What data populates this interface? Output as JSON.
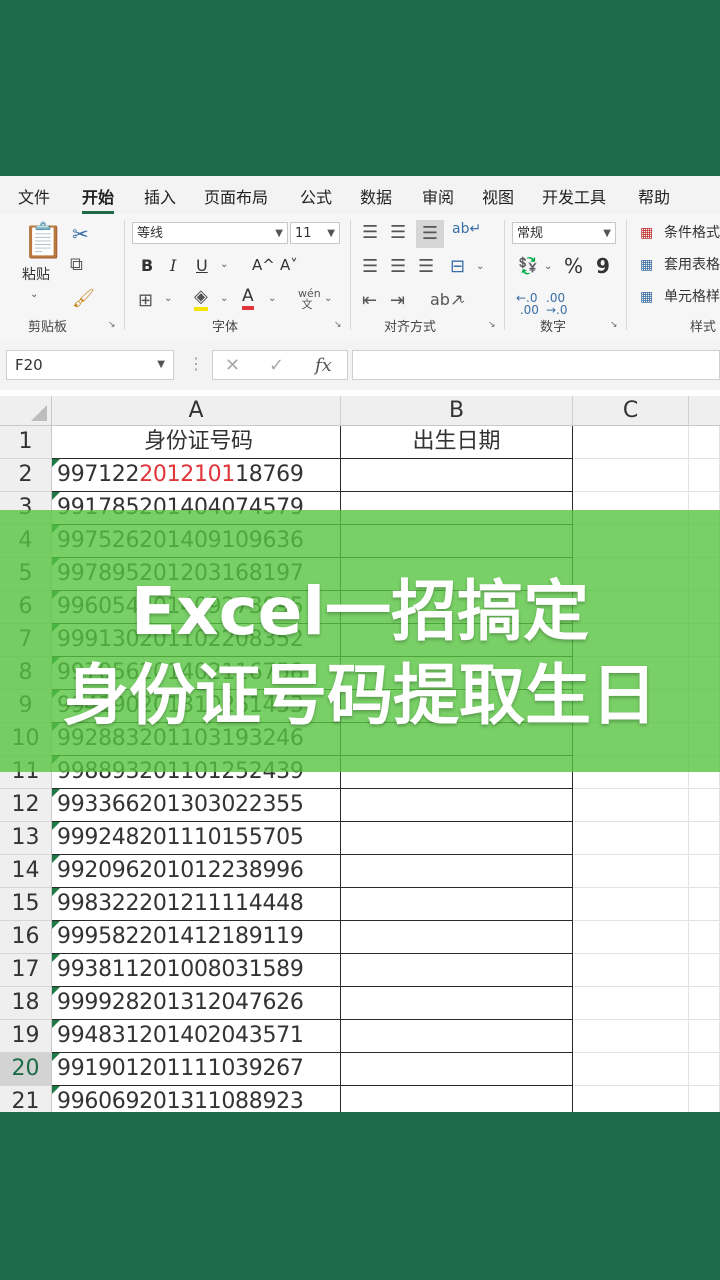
{
  "ribbon_tabs": [
    "文件",
    "开始",
    "插入",
    "页面布局",
    "公式",
    "数据",
    "审阅",
    "视图",
    "开发工具",
    "帮助"
  ],
  "ribbon": {
    "paste_label": "粘贴",
    "font_name": "等线",
    "font_size": "11",
    "number_format": "常规",
    "bold": "B",
    "italic": "I",
    "underline": "U",
    "grow_font": "A^",
    "shrink_font": "A˅",
    "font_color": "A",
    "percent": "%",
    "comma": "9",
    "conditional_format": "条件格式",
    "table_format": "套用表格",
    "cell_style": "单元格样",
    "groups": {
      "clipboard": "剪贴板",
      "font": "字体",
      "alignment": "对齐方式",
      "number": "数字",
      "styles": "样式"
    }
  },
  "formula_bar": {
    "name_box": "F20",
    "cancel": "✕",
    "enter": "✓",
    "fx": "fx",
    "value": ""
  },
  "columns": [
    "A",
    "B",
    "C"
  ],
  "rows": [
    {
      "n": "1",
      "a": "身份证号码",
      "b": "出生日期"
    },
    {
      "n": "2",
      "a_pre": "997122",
      "a_red": "2012101",
      "a_post": "18769",
      "b": ""
    },
    {
      "n": "3",
      "a": "991785201404074579",
      "b": ""
    },
    {
      "n": "4",
      "a": "997526201409109636",
      "b": ""
    },
    {
      "n": "5",
      "a": "997895201203168197",
      "b": ""
    },
    {
      "n": "6",
      "a": "996054201409273095",
      "b": ""
    },
    {
      "n": "7",
      "a": "999130201102208352",
      "b": ""
    },
    {
      "n": "8",
      "a": "997056201402116758",
      "b": ""
    },
    {
      "n": "9",
      "a": "994190201310261453",
      "b": ""
    },
    {
      "n": "10",
      "a": "992883201103193246",
      "b": ""
    },
    {
      "n": "11",
      "a": "998893201101252439",
      "b": ""
    },
    {
      "n": "12",
      "a": "993366201303022355",
      "b": ""
    },
    {
      "n": "13",
      "a": "999248201110155705",
      "b": ""
    },
    {
      "n": "14",
      "a": "992096201012238996",
      "b": ""
    },
    {
      "n": "15",
      "a": "998322201211114448",
      "b": ""
    },
    {
      "n": "16",
      "a": "999582201412189119",
      "b": ""
    },
    {
      "n": "17",
      "a": "993811201008031589",
      "b": ""
    },
    {
      "n": "18",
      "a": "999928201312047626",
      "b": ""
    },
    {
      "n": "19",
      "a": "994831201402043571",
      "b": ""
    },
    {
      "n": "20",
      "a": "991901201111039267",
      "b": ""
    },
    {
      "n": "21",
      "a": "996069201311088923",
      "b": ""
    }
  ],
  "selected_row": "20",
  "overlay": {
    "line1": "Excel一招搞定",
    "line2": "身份证号码提取生日",
    "color": "#56c440"
  },
  "colors": {
    "background": "#1d6b48",
    "accent_red": "#e0353a"
  }
}
